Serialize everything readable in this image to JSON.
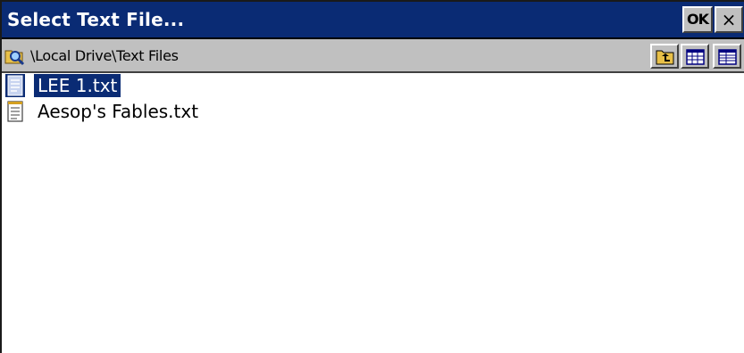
{
  "dialog": {
    "title": "Select Text File...",
    "ok_label": "OK",
    "close_label": "×"
  },
  "pathbar": {
    "path": "\\Local Drive\\Text Files",
    "icons": {
      "location": "folder-search-icon",
      "up": "up-folder-icon",
      "list_view": "list-view-icon",
      "details_view": "details-view-icon"
    }
  },
  "files": [
    {
      "name": "LEE 1.txt",
      "icon": "text-file-icon",
      "selected": true
    },
    {
      "name": "Aesop's Fables.txt",
      "icon": "text-file-icon",
      "selected": false
    }
  ],
  "colors": {
    "titlebar": "#0a2b74",
    "chrome": "#c0c0c0",
    "selection": "#0a2b74"
  }
}
